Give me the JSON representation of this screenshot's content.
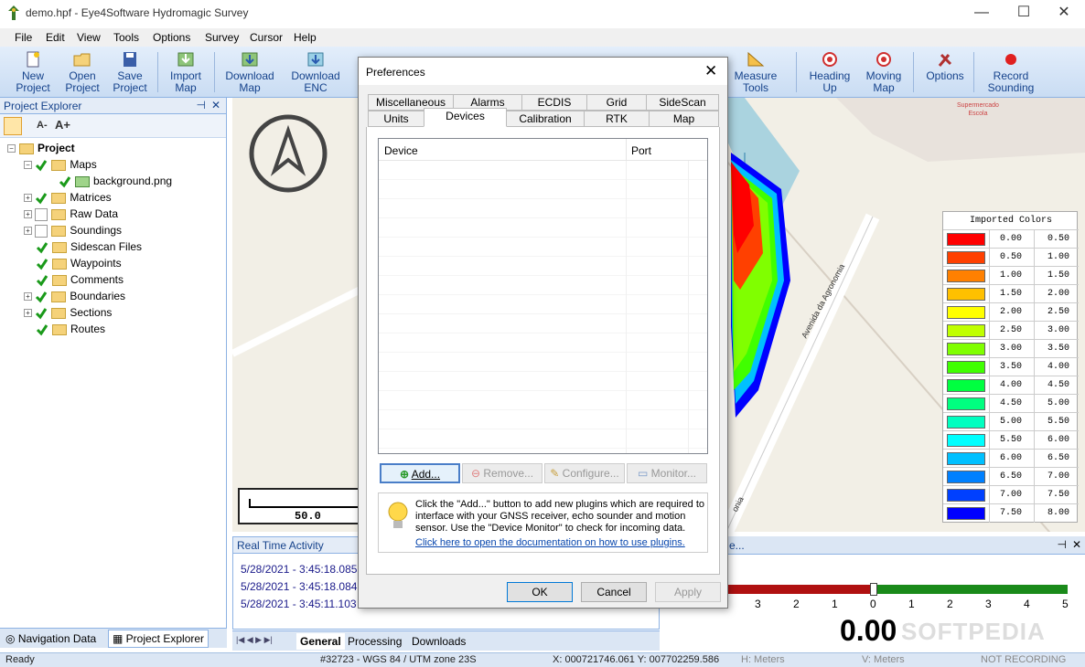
{
  "window": {
    "title": "demo.hpf - Eye4Software Hydromagic Survey"
  },
  "menu": [
    "File",
    "Edit",
    "View",
    "Tools",
    "Options",
    "Survey",
    "Cursor",
    "Help"
  ],
  "toolbar": {
    "new_project": [
      "New",
      "Project"
    ],
    "open_project": [
      "Open",
      "Project"
    ],
    "save_project": [
      "Save",
      "Project"
    ],
    "import_map": [
      "Import",
      "Map"
    ],
    "download_map": [
      "Download",
      "Map"
    ],
    "download_enc": [
      "Download",
      "ENC"
    ],
    "measure_tools": [
      "Measure",
      "Tools"
    ],
    "heading_up": [
      "Heading",
      "Up"
    ],
    "moving_map": [
      "Moving",
      "Map"
    ],
    "options": [
      "Options"
    ],
    "record_sounding": [
      "Record",
      "Sounding"
    ]
  },
  "project_explorer": {
    "title": "Project Explorer",
    "font_smaller": "A-",
    "font_larger": "A+",
    "root": "Project",
    "items": [
      {
        "label": "Maps",
        "checked": true,
        "expanded": true
      },
      {
        "label": "background.png",
        "checked": true,
        "child": true
      },
      {
        "label": "Matrices",
        "checked": true
      },
      {
        "label": "Raw Data",
        "checked": false
      },
      {
        "label": "Soundings",
        "checked": false
      },
      {
        "label": "Sidescan Files",
        "checked": true
      },
      {
        "label": "Waypoints",
        "checked": true
      },
      {
        "label": "Comments",
        "checked": true
      },
      {
        "label": "Boundaries",
        "checked": true
      },
      {
        "label": "Sections",
        "checked": true
      },
      {
        "label": "Routes",
        "checked": true
      }
    ],
    "bottom_tabs": [
      "Navigation Data",
      "Project Explorer"
    ]
  },
  "map": {
    "scale_label": "50.0",
    "street_label": "Avenida da Agronomia",
    "poi_label": [
      "Supermercado",
      "Escola"
    ],
    "street_label2": "onia"
  },
  "legend": {
    "title": "Imported Colors",
    "rows": [
      {
        "color": "#ff0000",
        "from": "0.00",
        "to": "0.50"
      },
      {
        "color": "#ff4000",
        "from": "0.50",
        "to": "1.00"
      },
      {
        "color": "#ff8000",
        "from": "1.00",
        "to": "1.50"
      },
      {
        "color": "#ffc000",
        "from": "1.50",
        "to": "2.00"
      },
      {
        "color": "#ffff00",
        "from": "2.00",
        "to": "2.50"
      },
      {
        "color": "#c0ff00",
        "from": "2.50",
        "to": "3.00"
      },
      {
        "color": "#80ff00",
        "from": "3.00",
        "to": "3.50"
      },
      {
        "color": "#40ff00",
        "from": "3.50",
        "to": "4.00"
      },
      {
        "color": "#00ff40",
        "from": "4.00",
        "to": "4.50"
      },
      {
        "color": "#00ff80",
        "from": "4.50",
        "to": "5.00"
      },
      {
        "color": "#00ffc0",
        "from": "5.00",
        "to": "5.50"
      },
      {
        "color": "#00ffff",
        "from": "5.50",
        "to": "6.00"
      },
      {
        "color": "#00c0ff",
        "from": "6.00",
        "to": "6.50"
      },
      {
        "color": "#0080ff",
        "from": "6.50",
        "to": "7.00"
      },
      {
        "color": "#0040ff",
        "from": "7.00",
        "to": "7.50"
      },
      {
        "color": "#0000ff",
        "from": "7.50",
        "to": "8.00"
      }
    ]
  },
  "activity": {
    "title": "Real Time Activity",
    "lines": [
      "5/28/2021 - 3:45:18.085 P",
      "5/28/2021 - 3:45:18.084 P",
      "5/28/2021 - 3:45:11.103 P"
    ],
    "tabs": [
      "General",
      "Processing",
      "Downloads"
    ]
  },
  "gauge": {
    "ticks": [
      "3",
      "2",
      "1",
      "0",
      "1",
      "2",
      "3",
      "4",
      "5"
    ],
    "value": "0.00",
    "watermark": "SOFTPEDIA",
    "dropdown": "e..."
  },
  "dialog": {
    "title": "Preferences",
    "tabs_row1": [
      "Miscellaneous",
      "Alarms",
      "ECDIS",
      "Grid",
      "SideScan"
    ],
    "tabs_row2": [
      "Units",
      "Devices",
      "Calibration",
      "RTK",
      "Map"
    ],
    "active_tab": "Devices",
    "columns": [
      "Device",
      "Port"
    ],
    "buttons": {
      "add": "Add...",
      "remove": "Remove...",
      "configure": "Configure...",
      "monitor": "Monitor..."
    },
    "info": "Click the \"Add...\" button to add new plugins which are required to interface with your GNSS receiver, echo sounder and motion sensor. Use the \"Device Monitor\" to check for incoming data.",
    "link": "Click here to open the documentation on how to use plugins.",
    "ok": "OK",
    "cancel": "Cancel",
    "apply": "Apply"
  },
  "status": {
    "ready": "Ready",
    "crs": "#32723 - WGS 84 / UTM zone 23S",
    "coords": "X: 000721746.061  Y: 007702259.586",
    "h": "H: Meters",
    "v": "V: Meters",
    "rec": "NOT RECORDING"
  }
}
